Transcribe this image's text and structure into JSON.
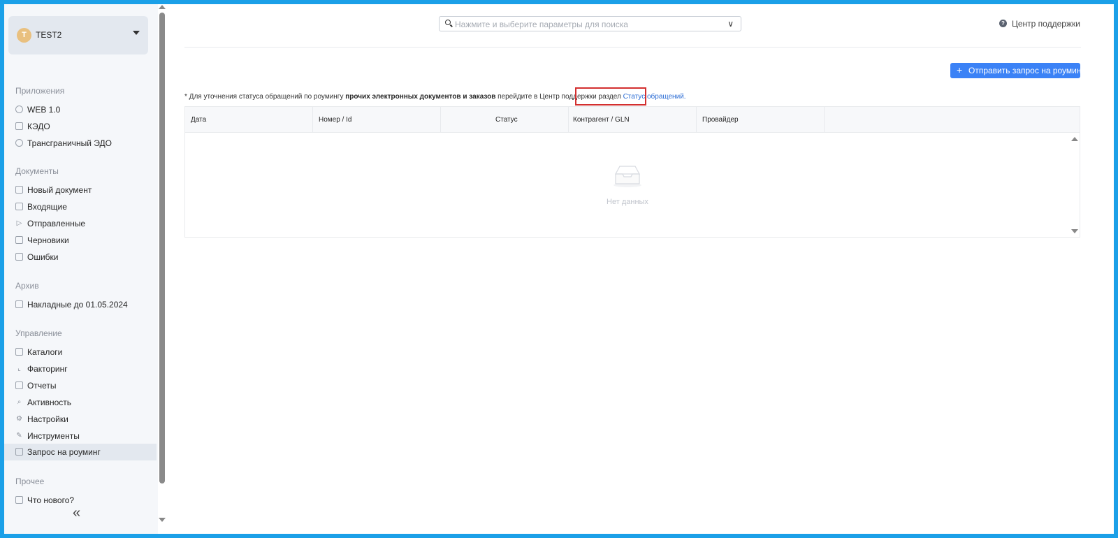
{
  "account": {
    "initial": "T",
    "name": "TEST2"
  },
  "sidebar": {
    "sections": [
      {
        "title": "Приложения"
      },
      {
        "title": "Документы"
      },
      {
        "title": "Архив"
      },
      {
        "title": "Управление"
      },
      {
        "title": "Прочее"
      }
    ],
    "items": [
      {
        "label": "WEB 1.0",
        "icon": "refresh-icon"
      },
      {
        "label": "КЭДО",
        "icon": "document-icon"
      },
      {
        "label": "Трансграничный ЭДО",
        "icon": "globe-icon"
      },
      {
        "label": "Новый документ",
        "icon": "new-document-icon"
      },
      {
        "label": "Входящие",
        "icon": "inbox-icon"
      },
      {
        "label": "Отправленные",
        "icon": "send-icon"
      },
      {
        "label": "Черновики",
        "icon": "draft-icon"
      },
      {
        "label": "Ошибки",
        "icon": "error-document-icon"
      },
      {
        "label": "Накладные до 01.05.2024",
        "icon": "archive-icon"
      },
      {
        "label": "Каталоги",
        "icon": "catalog-icon"
      },
      {
        "label": "Факторинг",
        "icon": "chart-icon"
      },
      {
        "label": "Отчеты",
        "icon": "report-icon"
      },
      {
        "label": "Активность",
        "icon": "search-icon"
      },
      {
        "label": "Настройки",
        "icon": "gear-icon"
      },
      {
        "label": "Инструменты",
        "icon": "wrench-icon"
      },
      {
        "label": "Запрос на роуминг",
        "icon": "roaming-icon",
        "active": true
      },
      {
        "label": "Что нового?",
        "icon": "mail-icon"
      }
    ],
    "collapse": "«"
  },
  "header": {
    "search_placeholder": "Нажмите и выберите параметры для поиска",
    "support_label": "Центр поддержки"
  },
  "main": {
    "roaming_button": "Отправить запрос на роуминг",
    "notice": {
      "prefix": "* Для уточнения статуса обращений по роумингу ",
      "bold": "прочих электронных документов и заказов",
      "middle": " перейдите в Центр поддержки раздел ",
      "link": "Статус обращений."
    },
    "table": {
      "columns": [
        "Дата",
        "Номер / Id",
        "Статус",
        "Контрагент / GLN",
        "Провайдер"
      ],
      "empty_text": "Нет данных"
    }
  },
  "colors": {
    "accent": "#3b82f6",
    "frame": "#1ba0e8",
    "highlight": "#d32f2f"
  }
}
